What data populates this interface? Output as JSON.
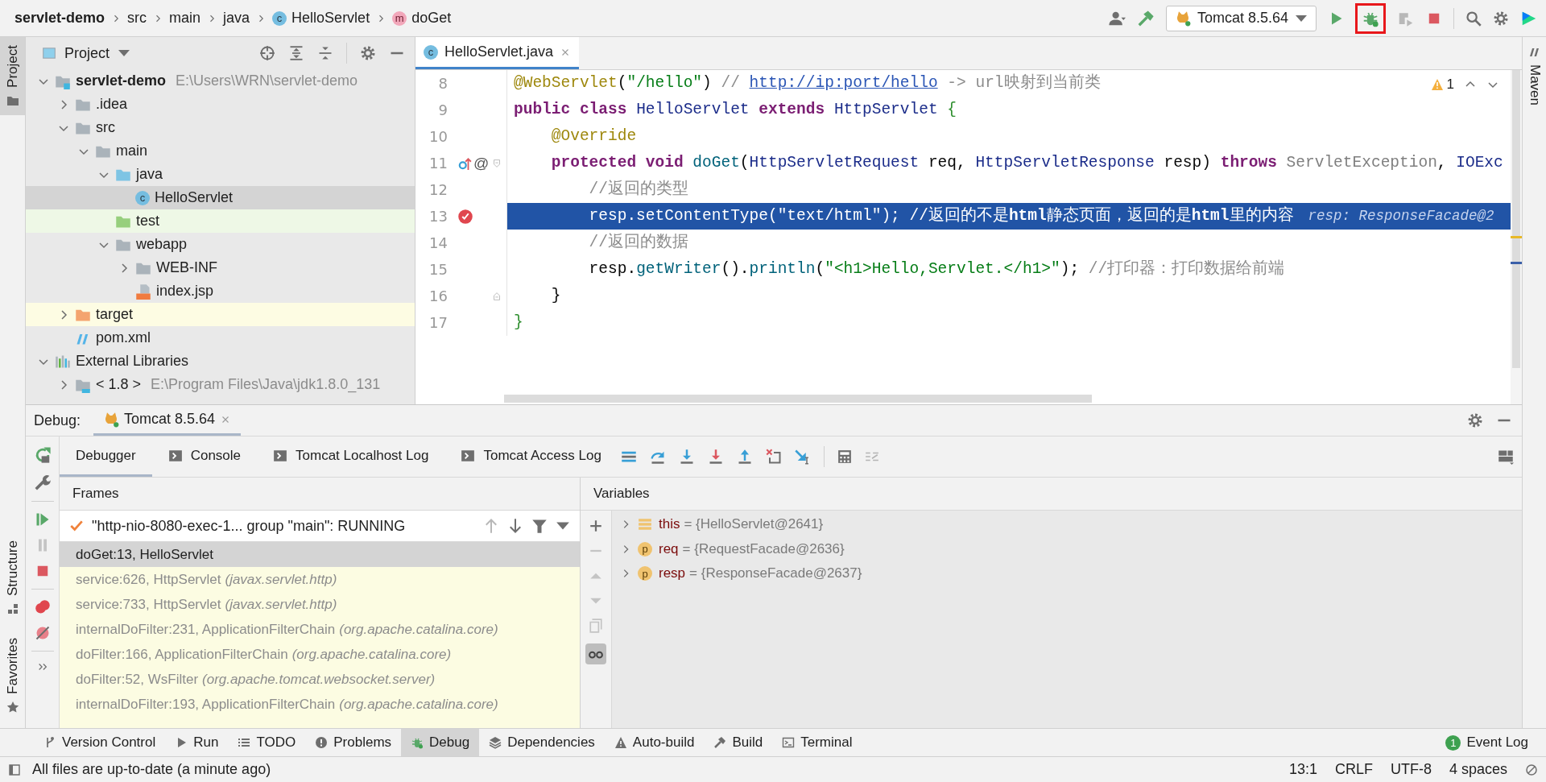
{
  "breadcrumbs": [
    {
      "label": "servlet-demo",
      "kind": "project"
    },
    {
      "label": "src",
      "kind": "folder"
    },
    {
      "label": "main",
      "kind": "folder"
    },
    {
      "label": "java",
      "kind": "folder"
    },
    {
      "label": "HelloServlet",
      "kind": "class",
      "badge": "c"
    },
    {
      "label": "doGet",
      "kind": "method",
      "badge": "m"
    }
  ],
  "toolbar": {
    "run_config": "Tomcat 8.5.64",
    "debug_highlighted": true
  },
  "left_strip": {
    "top": [
      {
        "label": "Project",
        "kind": "project",
        "selected": true
      }
    ],
    "bottom": [
      {
        "label": "Structure",
        "kind": "structure",
        "selected": false
      },
      {
        "label": "Favorites",
        "kind": "favorites",
        "selected": false
      }
    ]
  },
  "right_strip": [
    {
      "label": "Maven",
      "kind": "maven",
      "selected": false
    }
  ],
  "project_panel": {
    "title": "Project",
    "tree": [
      {
        "label": "servlet-demo",
        "kind": "module",
        "path": "E:\\Users\\WRN\\servlet-demo",
        "expanded": true,
        "selected": false,
        "children": [
          {
            "label": ".idea",
            "kind": "folder",
            "expanded": false,
            "selected": false
          },
          {
            "label": "src",
            "kind": "folder",
            "expanded": true,
            "selected": false,
            "children": [
              {
                "label": "main",
                "kind": "folder",
                "expanded": true,
                "selected": false,
                "children": [
                  {
                    "label": "java",
                    "kind": "source",
                    "expanded": true,
                    "selected": false,
                    "children": [
                      {
                        "label": "HelloServlet",
                        "kind": "class",
                        "badge": "c",
                        "selected": true
                      }
                    ]
                  },
                  {
                    "label": "test",
                    "kind": "test",
                    "selected": false
                  },
                  {
                    "label": "webapp",
                    "kind": "folder",
                    "expanded": true,
                    "selected": false,
                    "children": [
                      {
                        "label": "WEB-INF",
                        "kind": "folder",
                        "expanded": false,
                        "selected": false
                      },
                      {
                        "label": "index.jsp",
                        "kind": "jsp",
                        "selected": false
                      }
                    ]
                  }
                ]
              }
            ]
          },
          {
            "label": "target",
            "kind": "excluded",
            "expanded": false,
            "selected": false
          },
          {
            "label": "pom.xml",
            "kind": "maven",
            "selected": false
          }
        ]
      },
      {
        "label": "External Libraries",
        "kind": "libraries",
        "expanded": true,
        "selected": false,
        "children": [
          {
            "label": "< 1.8 >",
            "kind": "jdk",
            "path": "E:\\Program Files\\Java\\jdk1.8.0_131",
            "expanded": false,
            "selected": false
          }
        ]
      }
    ]
  },
  "editor": {
    "tabs": [
      {
        "label": "HelloServlet.java",
        "badge": "c",
        "selected": true
      }
    ],
    "warnings": "1",
    "lines": [
      {
        "number": "8",
        "current": false,
        "segments": [
          {
            "kind": "annotation",
            "text": "@WebServlet"
          },
          {
            "kind": "plain",
            "text": "("
          },
          {
            "kind": "string",
            "text": "\"/hello\""
          },
          {
            "kind": "plain",
            "text": ")"
          },
          {
            "kind": "comment",
            "text": " // "
          },
          {
            "kind": "link",
            "text": "http://ip:port/hello"
          },
          {
            "kind": "comment",
            "text": " -> url映射到当前类"
          }
        ]
      },
      {
        "number": "9",
        "current": false,
        "segments": [
          {
            "kind": "keyword",
            "text": "public class "
          },
          {
            "kind": "type",
            "text": "HelloServlet"
          },
          {
            "kind": "keyword",
            "text": " extends "
          },
          {
            "kind": "type",
            "text": "HttpServlet"
          },
          {
            "kind": "brace",
            "text": " {"
          }
        ]
      },
      {
        "number": "10",
        "current": false,
        "segments": [
          {
            "kind": "annotation",
            "text": "    @Override"
          }
        ]
      },
      {
        "number": "11",
        "current": false,
        "fold": {
          "kind": "start"
        },
        "gutter": [
          {
            "kind": "override"
          },
          {
            "kind": "symbol",
            "text": "@"
          }
        ],
        "segments": [
          {
            "kind": "keyword",
            "text": "    protected void "
          },
          {
            "kind": "method",
            "text": "doGet"
          },
          {
            "kind": "plain",
            "text": "("
          },
          {
            "kind": "type",
            "text": "HttpServletRequest"
          },
          {
            "kind": "plain",
            "text": " req, "
          },
          {
            "kind": "type",
            "text": "HttpServletResponse"
          },
          {
            "kind": "plain",
            "text": " resp) "
          },
          {
            "kind": "keyword",
            "text": "throws "
          },
          {
            "kind": "dim",
            "text": "ServletException"
          },
          {
            "kind": "plain",
            "text": ", "
          },
          {
            "kind": "type",
            "text": "IOExc"
          }
        ]
      },
      {
        "number": "12",
        "current": false,
        "segments": [
          {
            "kind": "comment",
            "text": "        //返回的类型"
          }
        ]
      },
      {
        "number": "13",
        "current": true,
        "gutter": [
          {
            "kind": "breakpoint"
          }
        ],
        "segments": [
          {
            "kind": "plain",
            "text": "        resp.setContentType("
          },
          {
            "kind": "string",
            "text": "\"text/html\""
          },
          {
            "kind": "plain",
            "text": "); "
          },
          {
            "kind": "comment",
            "text": "//返回的不是"
          },
          {
            "kind": "comment_bold",
            "text": "html"
          },
          {
            "kind": "comment",
            "text": "静态页面，返回的是"
          },
          {
            "kind": "comment_bold",
            "text": "html"
          },
          {
            "kind": "comment",
            "text": "里的内容"
          },
          {
            "kind": "hint",
            "text": "resp: ResponseFacade@2"
          }
        ]
      },
      {
        "number": "14",
        "current": false,
        "segments": [
          {
            "kind": "comment",
            "text": "        //返回的数据"
          }
        ]
      },
      {
        "number": "15",
        "current": false,
        "segments": [
          {
            "kind": "plain",
            "text": "        resp."
          },
          {
            "kind": "method",
            "text": "getWriter"
          },
          {
            "kind": "plain",
            "text": "()."
          },
          {
            "kind": "method",
            "text": "println"
          },
          {
            "kind": "plain",
            "text": "("
          },
          {
            "kind": "string",
            "text": "\"<h1>Hello,Servlet.</h1>\""
          },
          {
            "kind": "plain",
            "text": "); "
          },
          {
            "kind": "comment",
            "text": "//打印器：打印数据给前端"
          }
        ]
      },
      {
        "number": "16",
        "current": false,
        "fold": {
          "kind": "end"
        },
        "segments": [
          {
            "kind": "plain",
            "text": "    }"
          }
        ]
      },
      {
        "number": "17",
        "current": false,
        "segments": [
          {
            "kind": "brace",
            "text": "}"
          }
        ]
      }
    ]
  },
  "debug": {
    "label": "Debug:",
    "sessions": [
      {
        "label": "Tomcat 8.5.64",
        "selected": true
      }
    ],
    "tabs": [
      {
        "label": "Debugger",
        "kind": "debugger",
        "selected": true
      },
      {
        "label": "Console",
        "kind": "console",
        "selected": false
      },
      {
        "label": "Tomcat Localhost Log",
        "kind": "console",
        "selected": false
      },
      {
        "label": "Tomcat Access Log",
        "kind": "console",
        "selected": false
      }
    ],
    "frames": {
      "title": "Frames",
      "thread": "\"http-nio-8080-exec-1... group \"main\": RUNNING",
      "items": [
        {
          "location": "doGet:13, HelloServlet",
          "kind": "user",
          "selected": true
        },
        {
          "location": "service:626, HttpServlet",
          "package": "(javax.servlet.http)",
          "kind": "library",
          "selected": false
        },
        {
          "location": "service:733, HttpServlet",
          "package": "(javax.servlet.http)",
          "kind": "library",
          "selected": false
        },
        {
          "location": "internalDoFilter:231, ApplicationFilterChain",
          "package": "(org.apache.catalina.core)",
          "kind": "library",
          "selected": false
        },
        {
          "location": "doFilter:166, ApplicationFilterChain",
          "package": "(org.apache.catalina.core)",
          "kind": "library",
          "selected": false
        },
        {
          "location": "doFilter:52, WsFilter",
          "package": "(org.apache.tomcat.websocket.server)",
          "kind": "library",
          "selected": false
        },
        {
          "location": "internalDoFilter:193, ApplicationFilterChain",
          "package": "(org.apache.catalina.core)",
          "kind": "library",
          "selected": false
        }
      ]
    },
    "variables": {
      "title": "Variables",
      "items": [
        {
          "name": "this",
          "value": "= {HelloServlet@2641}",
          "kind": "field"
        },
        {
          "name": "req",
          "value": "= {RequestFacade@2636}",
          "kind": "param",
          "badge": "p"
        },
        {
          "name": "resp",
          "value": "= {ResponseFacade@2637}",
          "kind": "param",
          "badge": "p"
        }
      ]
    }
  },
  "tool_windows": [
    {
      "label": "Version Control",
      "kind": "vcs",
      "selected": false
    },
    {
      "label": "Run",
      "kind": "run",
      "selected": false
    },
    {
      "label": "TODO",
      "kind": "todo",
      "selected": false
    },
    {
      "label": "Problems",
      "kind": "problems",
      "selected": false
    },
    {
      "label": "Debug",
      "kind": "debug",
      "selected": true
    },
    {
      "label": "Dependencies",
      "kind": "dependencies",
      "selected": false
    },
    {
      "label": "Auto-build",
      "kind": "autobuild",
      "selected": false
    },
    {
      "label": "Build",
      "kind": "build",
      "selected": false
    },
    {
      "label": "Terminal",
      "kind": "terminal",
      "selected": false
    }
  ],
  "event_log": {
    "label": "Event Log",
    "count": "1"
  },
  "status_bar": {
    "message": "All files are up-to-date (a minute ago)",
    "items": [
      "13:1",
      "CRLF",
      "UTF-8",
      "4 spaces"
    ]
  }
}
